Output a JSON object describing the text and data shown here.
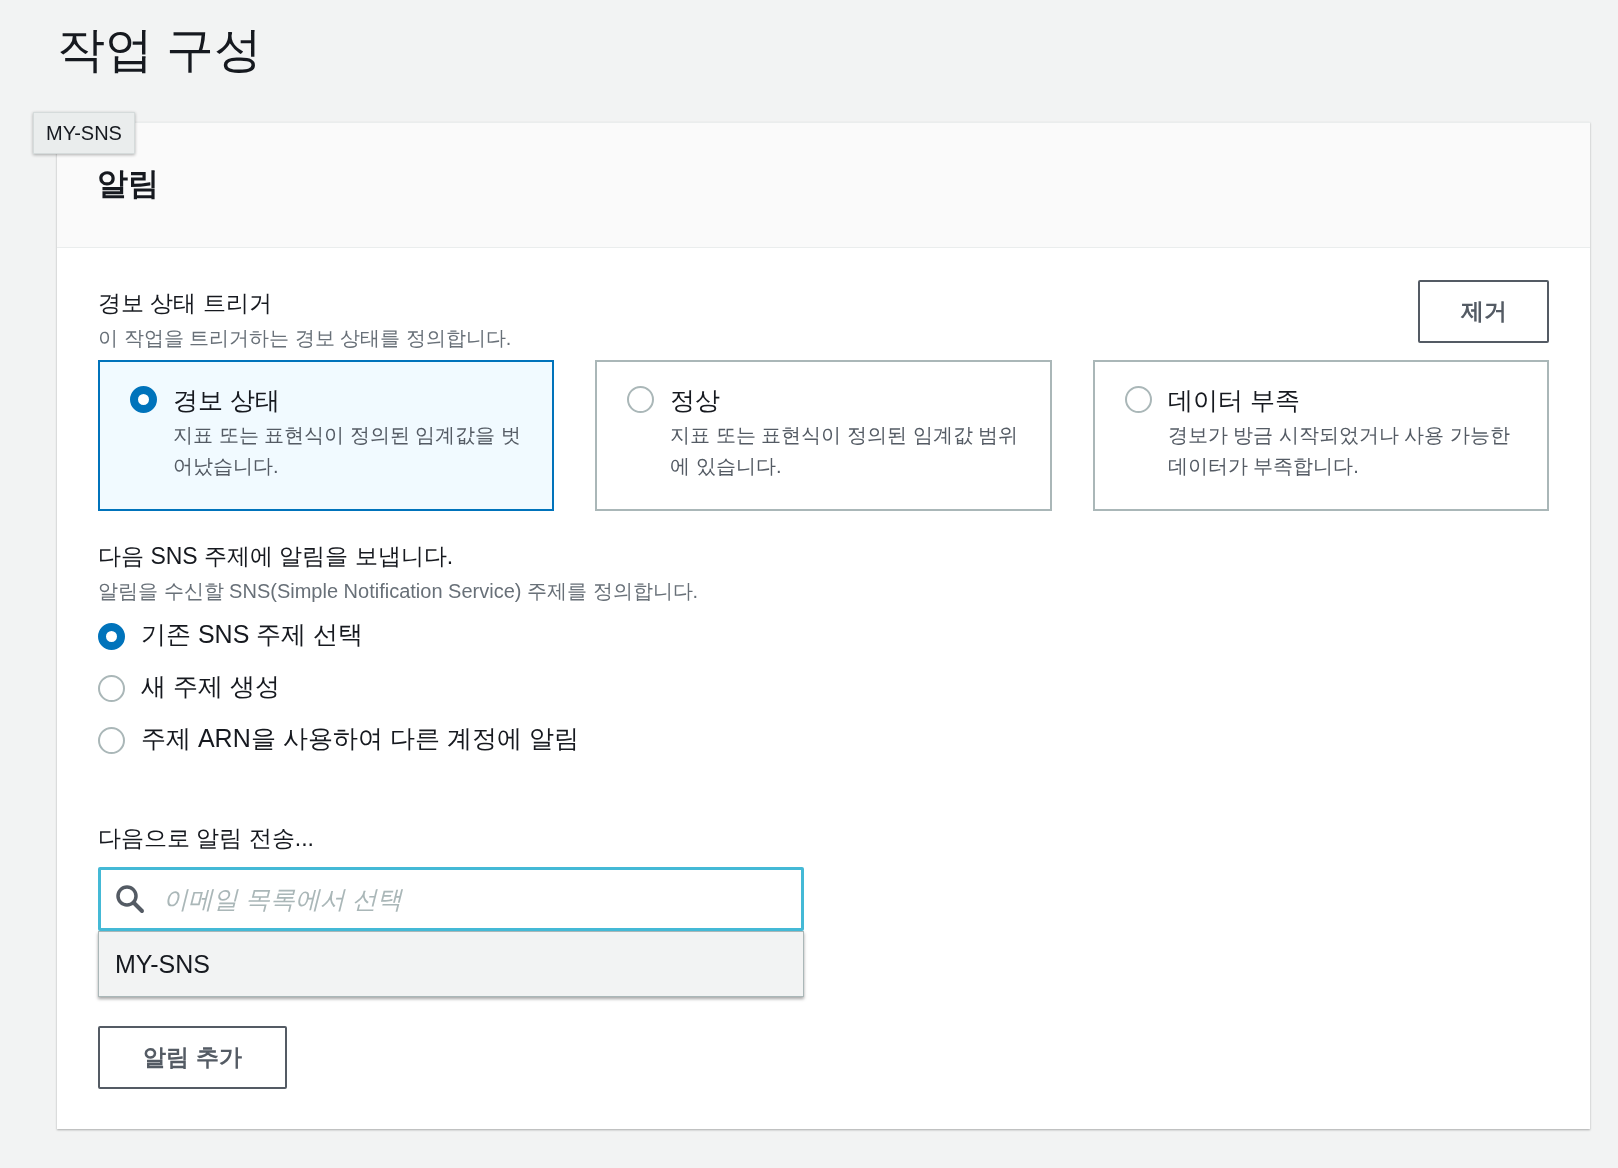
{
  "page_title": "작업 구성",
  "tooltip": "MY-SNS",
  "section": {
    "title": "알림",
    "trigger": {
      "label": "경보 상태 트리거",
      "description": "이 작업을 트리거하는 경보 상태를 정의합니다.",
      "remove_button": "제거",
      "options": [
        {
          "title": "경보 상태",
          "description": "지표 또는 표현식이 정의된 임계값을 벗어났습니다.",
          "selected": true
        },
        {
          "title": "정상",
          "description": "지표 또는 표현식이 정의된 임계값 범위에 있습니다.",
          "selected": false
        },
        {
          "title": "데이터 부족",
          "description": "경보가 방금 시작되었거나 사용 가능한 데이터가 부족합니다.",
          "selected": false
        }
      ]
    },
    "sns": {
      "label": "다음 SNS 주제에 알림을 보냅니다.",
      "description": "알림을 수신할 SNS(Simple Notification Service) 주제를 정의합니다.",
      "options": [
        {
          "label": "기존 SNS 주제 선택",
          "selected": true
        },
        {
          "label": "새 주제 생성",
          "selected": false
        },
        {
          "label": "주제 ARN을 사용하여 다른 계정에 알림",
          "selected": false
        }
      ]
    },
    "send_to": {
      "label": "다음으로 알림 전송...",
      "search": {
        "placeholder": "이메일 목록에서 선택"
      },
      "dropdown_items": [
        "MY-SNS"
      ]
    },
    "add_button": "알림 추가"
  }
}
